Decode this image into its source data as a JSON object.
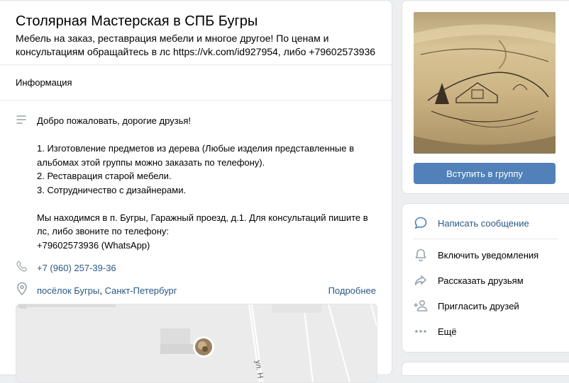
{
  "group": {
    "title": "Столярная Мастерская в СПБ Бугры",
    "status": "Мебель на заказ, реставрация мебели и многое другое! По ценам и консультациям обращайтесь в лс https://vk.com/id927954, либо +79602573936"
  },
  "info": {
    "header": "Информация",
    "description": "Добро пожаловать, дорогие друзья!\n\n1. Изготовление предметов из дерева (Любые изделия представленные в альбомах этой группы можно заказать по телефону).\n2. Реставрация старой мебели.\n3. Сотрудничество с дизайнерами.\n\nМы находимся в п. Бугры, Гаражный проезд, д.1. Для консультаций пишите в лс, либо звоните по телефону:\n+79602573936 (WhatsApp)",
    "phone": "+7 (960) 257-39-36",
    "address_place": "посёлок Бугры",
    "address_separator": ", ",
    "address_city": "Санкт-Петербург",
    "more_link": "Подробнее",
    "map_street_label": "ул. Н"
  },
  "sidebar": {
    "join_button": "Вступить в группу",
    "actions": [
      {
        "label": "Написать сообщение",
        "icon": "message-icon"
      },
      {
        "label": "Включить уведомления",
        "icon": "bell-icon"
      },
      {
        "label": "Рассказать друзьям",
        "icon": "share-icon"
      },
      {
        "label": "Пригласить друзей",
        "icon": "add-user-icon"
      },
      {
        "label": "Ещё",
        "icon": "more-icon"
      }
    ]
  },
  "colors": {
    "accent": "#5181b8",
    "link": "#2a5885",
    "icon": "#99a2ad",
    "background": "#edeef0"
  }
}
